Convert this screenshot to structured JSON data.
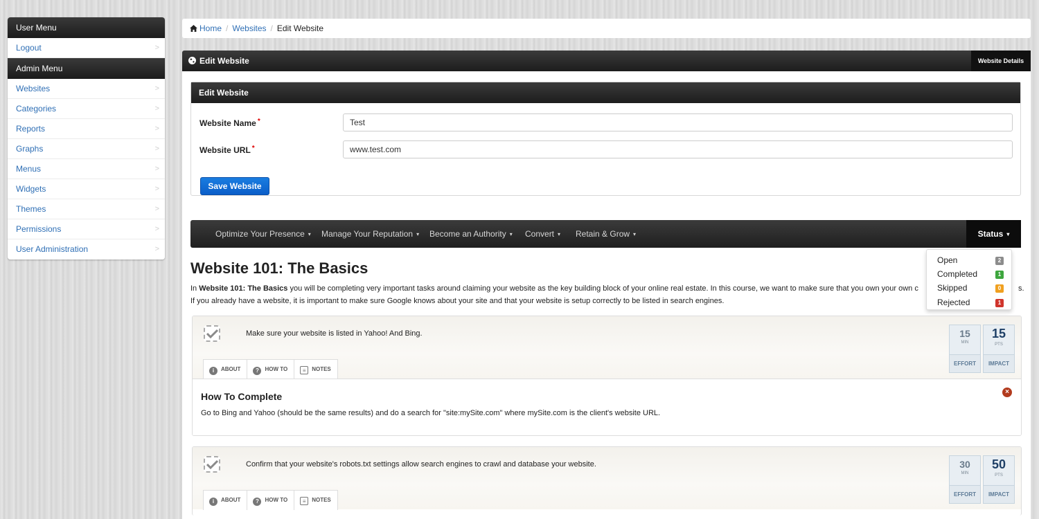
{
  "sidebar": {
    "user_menu_title": "User Menu",
    "user_items": [
      {
        "label": "Logout"
      }
    ],
    "admin_menu_title": "Admin Menu",
    "admin_items": [
      {
        "label": "Websites"
      },
      {
        "label": "Categories"
      },
      {
        "label": "Reports"
      },
      {
        "label": "Graphs"
      },
      {
        "label": "Menus"
      },
      {
        "label": "Widgets"
      },
      {
        "label": "Themes"
      },
      {
        "label": "Permissions"
      },
      {
        "label": "User Administration"
      }
    ]
  },
  "breadcrumb": {
    "home": "Home",
    "websites": "Websites",
    "current": "Edit Website"
  },
  "panel": {
    "title": "Edit Website",
    "tab": "Website Details"
  },
  "form": {
    "title": "Edit Website",
    "name_label": "Website Name",
    "name_value": "Test",
    "url_label": "Website URL",
    "url_value": "www.test.com",
    "required_mark": "*",
    "save_label": "Save Website"
  },
  "course_nav": {
    "items": [
      {
        "label": "Optimize Your Presence"
      },
      {
        "label": "Manage Your Reputation"
      },
      {
        "label": "Become an Authority"
      },
      {
        "label": "Convert"
      },
      {
        "label": "Retain & Grow"
      }
    ],
    "caret": "▾",
    "status_label": "Status"
  },
  "status_menu": [
    {
      "label": "Open",
      "count": "2",
      "color": "#8c8c8c"
    },
    {
      "label": "Completed",
      "count": "1",
      "color": "#3ea63e"
    },
    {
      "label": "Skipped",
      "count": "0",
      "color": "#f0a020"
    },
    {
      "label": "Rejected",
      "count": "1",
      "color": "#d0352c"
    }
  ],
  "course": {
    "title": "Website 101: The Basics",
    "desc_prefix": "In ",
    "desc_bold": "Website 101: The Basics",
    "desc_line1": " you will be completing very important tasks around claiming your website as the key building block of your online real estate. In this course, we want to make sure that you own your own c",
    "desc_line1_end": "s.",
    "desc_line2": "If you already have a website, it is important to make sure Google knows about your site and that your website is setup correctly to be listed in search engines."
  },
  "tabs": {
    "about": "ABOUT",
    "howto": "HOW TO",
    "notes": "NOTES"
  },
  "tasks": [
    {
      "text": "Make sure your website is listed in Yahoo! And Bing.",
      "effort": "15",
      "effort_unit": "MIN",
      "effort_label": "EFFORT",
      "impact": "15",
      "impact_unit": "PTS",
      "impact_label": "IMPACT",
      "body_title": "How To Complete",
      "body_text": "Go to Bing and Yahoo (should be the same results) and do a search for \"site:mySite.com\" where mySite.com is the client's website URL."
    },
    {
      "text": "Confirm that your website's robots.txt settings allow search engines to crawl and database your website.",
      "effort": "30",
      "effort_unit": "MIN",
      "effort_label": "EFFORT",
      "impact": "50",
      "impact_unit": "PTS",
      "impact_label": "IMPACT"
    }
  ],
  "colors": {
    "link": "#2f6fb5",
    "primary_button": "#0b5ec9",
    "header_dark": "#1d1d1d"
  }
}
